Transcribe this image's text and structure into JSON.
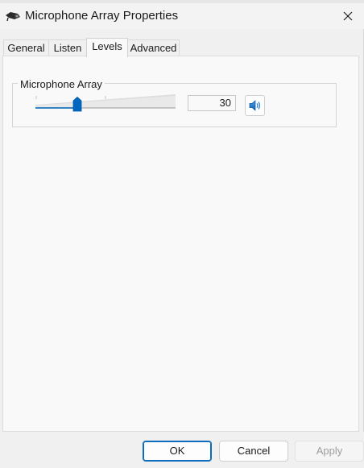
{
  "window": {
    "title": "Microphone Array Properties"
  },
  "tabs": [
    {
      "label": "General"
    },
    {
      "label": "Listen"
    },
    {
      "label": "Levels"
    },
    {
      "label": "Advanced"
    }
  ],
  "active_tab": "Levels",
  "levels": {
    "group_label": "Microphone Array",
    "slider_value": 30,
    "slider_max": 100,
    "value_text": "30"
  },
  "footer": {
    "ok_label": "OK",
    "cancel_label": "Cancel",
    "apply_label": "Apply"
  },
  "colors": {
    "accent": "#0f6cbd",
    "thumb": "#0067c0"
  },
  "icons": {
    "app": "microphone-icon",
    "close": "close-icon",
    "mute": "speaker-icon"
  }
}
